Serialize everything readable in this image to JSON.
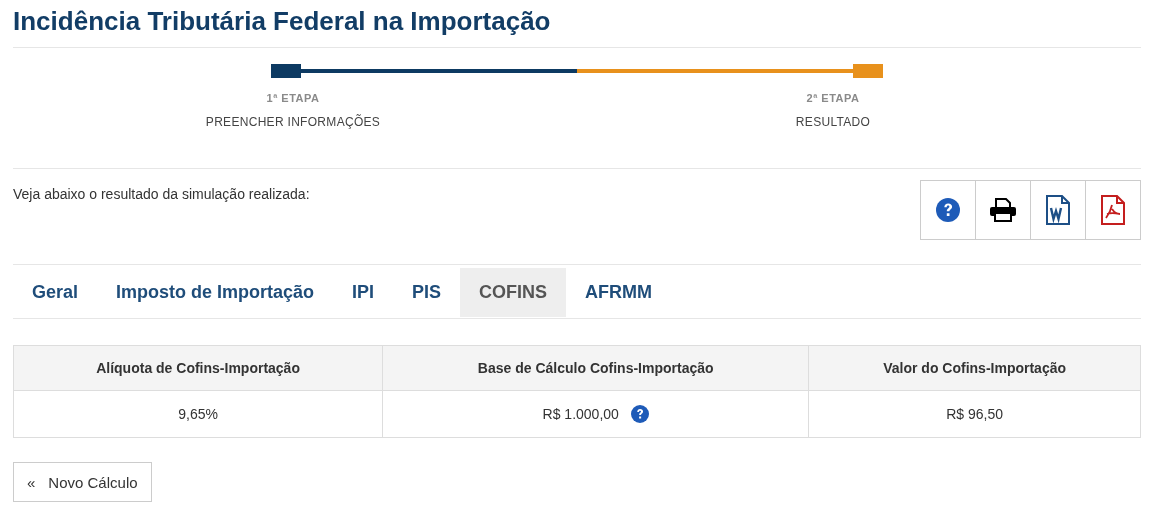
{
  "title": "Incidência Tributária Federal na Importação",
  "steps": [
    {
      "number": "1ª ETAPA",
      "label": "PREENCHER INFORMAÇÕES",
      "color": "#0d3a62"
    },
    {
      "number": "2ª ETAPA",
      "label": "RESULTADO",
      "color": "#e8911c"
    }
  ],
  "intro": "Veja abaixo o resultado da simulação realizada:",
  "actions": [
    {
      "kind": "help"
    },
    {
      "kind": "print"
    },
    {
      "kind": "word"
    },
    {
      "kind": "pdf"
    }
  ],
  "tabs": [
    {
      "label": "Geral",
      "selected": false
    },
    {
      "label": "Imposto de Importação",
      "selected": false
    },
    {
      "label": "IPI",
      "selected": false
    },
    {
      "label": "PIS",
      "selected": false
    },
    {
      "label": "COFINS",
      "selected": true
    },
    {
      "label": "AFRMM",
      "selected": false
    }
  ],
  "table": {
    "columns": [
      "Alíquota de Cofins-Importação",
      "Base de Cálculo Cofins-Importação",
      "Valor do Cofins-Importação"
    ],
    "rows": [
      [
        {
          "text": "9,65%",
          "help": false
        },
        {
          "text": "R$ 1.000,00",
          "help": true
        },
        {
          "text": "R$ 96,50",
          "help": false
        }
      ]
    ]
  },
  "new_button": {
    "icon": "«",
    "label": "Novo Cálculo"
  }
}
